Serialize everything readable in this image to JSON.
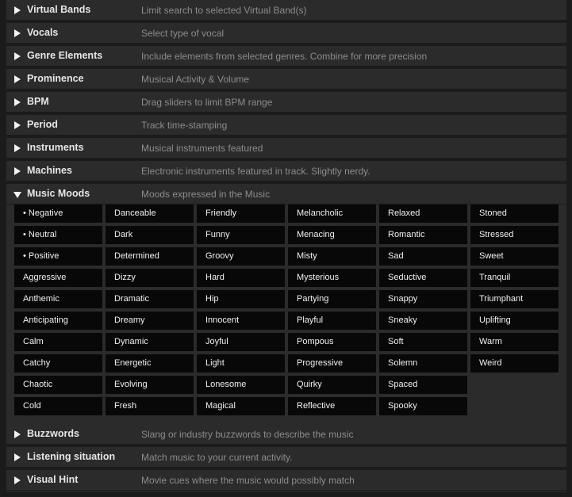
{
  "sections_top": [
    {
      "title": "Virtual Bands",
      "desc": "Limit search to selected Virtual Band(s)"
    },
    {
      "title": "Vocals",
      "desc": "Select type of vocal"
    },
    {
      "title": "Genre Elements",
      "desc": "Include elements from selected genres. Combine for more precision"
    },
    {
      "title": "Prominence",
      "desc": "Musical Activity & Volume"
    },
    {
      "title": "BPM",
      "desc": "Drag sliders to limit BPM range"
    },
    {
      "title": "Period",
      "desc": "Track time-stamping"
    },
    {
      "title": "Instruments",
      "desc": "Musical instruments featured"
    },
    {
      "title": "Machines",
      "desc": "Electronic instruments featured in track. Slightly nerdy."
    }
  ],
  "music_moods": {
    "title": "Music Moods",
    "desc": "Moods expressed in the Music",
    "columns": [
      [
        "• Negative",
        "• Neutral",
        "• Positive",
        "Aggressive",
        "Anthemic",
        "Anticipating",
        "Calm",
        "Catchy",
        "Chaotic",
        "Cold"
      ],
      [
        "Danceable",
        "Dark",
        "Determined",
        "Dizzy",
        "Dramatic",
        "Dreamy",
        "Dynamic",
        "Energetic",
        "Evolving",
        "Fresh"
      ],
      [
        "Friendly",
        "Funny",
        "Groovy",
        "Hard",
        "Hip",
        "Innocent",
        "Joyful",
        "Light",
        "Lonesome",
        "Magical"
      ],
      [
        "Melancholic",
        "Menacing",
        "Misty",
        "Mysterious",
        "Partying",
        "Playful",
        "Pompous",
        "Progressive",
        "Quirky",
        "Reflective"
      ],
      [
        "Relaxed",
        "Romantic",
        "Sad",
        "Seductive",
        "Snappy",
        "Sneaky",
        "Soft",
        "Solemn",
        "Spaced",
        "Spooky"
      ],
      [
        "Stoned",
        "Stressed",
        "Sweet",
        "Tranquil",
        "Triumphant",
        "Uplifting",
        "Warm",
        "Weird"
      ]
    ]
  },
  "sections_bottom": [
    {
      "title": "Buzzwords",
      "desc": "Slang or industry buzzwords to describe the music"
    },
    {
      "title": "Listening situation",
      "desc": "Match music to your current activity."
    },
    {
      "title": "Visual Hint",
      "desc": "Movie cues where the music would possibly match"
    }
  ]
}
